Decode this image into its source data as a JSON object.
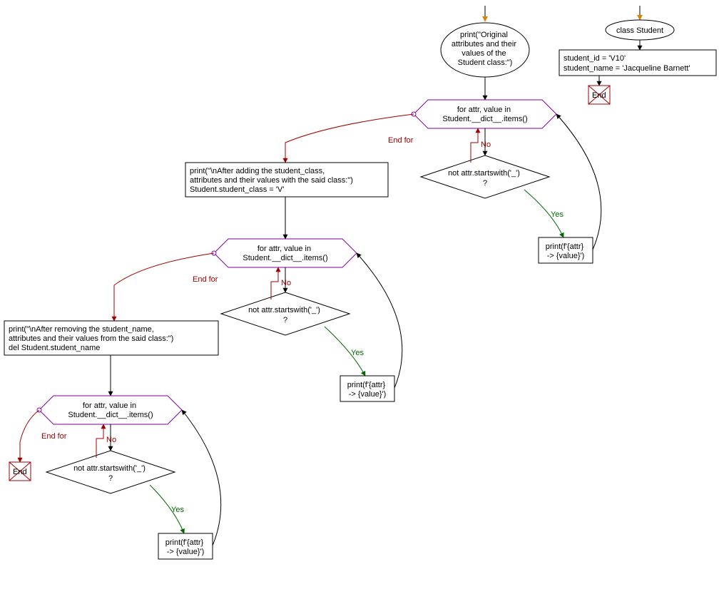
{
  "main": {
    "start_ellipse": {
      "l1": "print(\"Original",
      "l2": "attributes and their",
      "l3": "values of the",
      "l4": "Student class:\")"
    },
    "loop1_hex": {
      "l1": "for attr, value in",
      "l2": "Student.__dict__.items()"
    },
    "cond1": {
      "l1": "not attr.startswith('_')",
      "l2": "?"
    },
    "print1": {
      "l1": "print(f'{attr}",
      "l2": "-> {value}')"
    },
    "block2": {
      "l1": "print(\"\\nAfter adding the student_class,",
      "l2": "attributes and their values with the said class:\")",
      "l3": "Student.student_class  = 'V'"
    },
    "loop2_hex": {
      "l1": "for attr, value in",
      "l2": "Student.__dict__.items()"
    },
    "cond2": {
      "l1": "not attr.startswith('_')",
      "l2": "?"
    },
    "print2": {
      "l1": "print(f'{attr}",
      "l2": "-> {value}')"
    },
    "block3": {
      "l1": "print(\"\\nAfter removing the student_name,",
      "l2": "attributes and their values from the said class:\")",
      "l3": "del Student.student_name"
    },
    "loop3_hex": {
      "l1": "for attr, value in",
      "l2": "Student.__dict__.items()"
    },
    "cond3": {
      "l1": "not attr.startswith('_')",
      "l2": "?"
    },
    "print3": {
      "l1": "print(f'{attr}",
      "l2": "-> {value}')"
    },
    "end_label": "End"
  },
  "side": {
    "class_ellipse": "class Student",
    "body": {
      "l1": "student_id = 'V10'",
      "l2": "student_name = 'Jacqueline Barnett'"
    },
    "end_label": "End"
  },
  "labels": {
    "end_for": "End for",
    "yes": "Yes",
    "no": "No"
  }
}
